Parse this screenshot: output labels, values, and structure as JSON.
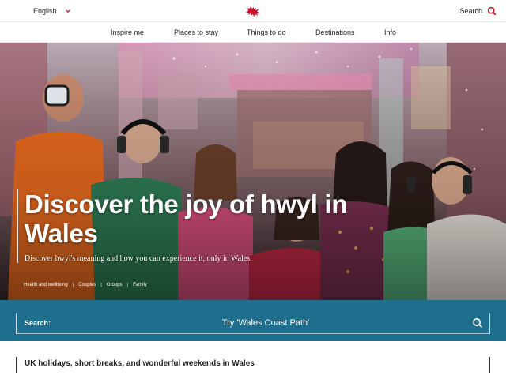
{
  "header": {
    "language": "English",
    "search_label": "Search"
  },
  "nav": {
    "items": [
      {
        "label": "Inspire me"
      },
      {
        "label": "Places to stay"
      },
      {
        "label": "Things to do"
      },
      {
        "label": "Destinations"
      },
      {
        "label": "Info"
      }
    ]
  },
  "hero": {
    "title": "Discover the joy of hwyl in Wales",
    "subtitle": "Discover hwyl's meaning and how you can experience it, only in Wales.",
    "tags": [
      "Health and wellbeing",
      "Couples",
      "Groups",
      "Family"
    ]
  },
  "search": {
    "label": "Search:",
    "placeholder": "Try 'Wales Coast Path'"
  },
  "intro": {
    "heading": "UK holidays, short breaks, and wonderful weekends in Wales"
  },
  "colors": {
    "brand_red": "#c8102e",
    "search_band": "#1e6e8e"
  }
}
